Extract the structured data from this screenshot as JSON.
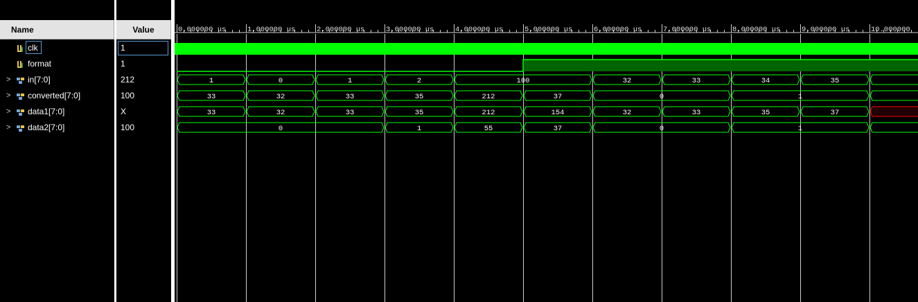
{
  "header": {
    "name_label": "Name",
    "value_label": "Value"
  },
  "colors": {
    "wave": "#00ff00",
    "dim_wave": "#006400",
    "grid": "#d0d0d0",
    "unknown": "#ff0000",
    "background": "#000000"
  },
  "signals": [
    {
      "name": "clk",
      "value": "1",
      "expandable": false,
      "icon": "bit-signal-icon",
      "selected": true
    },
    {
      "name": "format",
      "value": "1",
      "expandable": false,
      "icon": "bit-signal-icon",
      "selected": false
    },
    {
      "name": "in[7:0]",
      "value": "212",
      "expandable": true,
      "icon": "bus-signal-icon",
      "selected": false
    },
    {
      "name": "converted[7:0]",
      "value": "100",
      "expandable": true,
      "icon": "bus-signal-icon",
      "selected": false
    },
    {
      "name": "data1[7:0]",
      "value": "X",
      "expandable": true,
      "icon": "bus-signal-icon",
      "selected": false
    },
    {
      "name": "data2[7:0]",
      "value": "100",
      "expandable": true,
      "icon": "bus-signal-icon",
      "selected": false
    }
  ],
  "timeline": {
    "unit": "us",
    "visible_range": [
      0,
      10.7
    ],
    "tick_labels": [
      "0.000000 us",
      "1.000000 us",
      "2.000000 us",
      "3.000000 us",
      "4.000000 us",
      "5.000000 us",
      "6.000000 us",
      "7.000000 us",
      "8.000000 us",
      "9.000000 us",
      "10.000000"
    ]
  },
  "waves": {
    "clk": {
      "type": "clock",
      "level": 1
    },
    "format": {
      "type": "bit",
      "transitions": [
        {
          "t": 0,
          "v": 0
        },
        {
          "t": 5,
          "v": 1
        }
      ]
    },
    "buses": [
      {
        "signal": "in[7:0]",
        "segments": [
          {
            "t0": 0,
            "t1": 1,
            "label": "1"
          },
          {
            "t0": 1,
            "t1": 2,
            "label": "0"
          },
          {
            "t0": 2,
            "t1": 3,
            "label": "1"
          },
          {
            "t0": 3,
            "t1": 4,
            "label": "2"
          },
          {
            "t0": 4,
            "t1": 6,
            "label": "100"
          },
          {
            "t0": 6,
            "t1": 7,
            "label": "32"
          },
          {
            "t0": 7,
            "t1": 8,
            "label": "33"
          },
          {
            "t0": 8,
            "t1": 9,
            "label": "34"
          },
          {
            "t0": 9,
            "t1": 10,
            "label": "35"
          },
          {
            "t0": 10,
            "t1": 10.8,
            "label": ""
          }
        ]
      },
      {
        "signal": "converted[7:0]",
        "segments": [
          {
            "t0": 0,
            "t1": 1,
            "label": "33"
          },
          {
            "t0": 1,
            "t1": 2,
            "label": "32"
          },
          {
            "t0": 2,
            "t1": 3,
            "label": "33"
          },
          {
            "t0": 3,
            "t1": 4,
            "label": "35"
          },
          {
            "t0": 4,
            "t1": 5,
            "label": "212"
          },
          {
            "t0": 5,
            "t1": 6,
            "label": "37"
          },
          {
            "t0": 6,
            "t1": 8,
            "label": "0"
          },
          {
            "t0": 8,
            "t1": 10,
            "label": "1"
          },
          {
            "t0": 10,
            "t1": 10.8,
            "label": ""
          }
        ]
      },
      {
        "signal": "data1[7:0]",
        "segments": [
          {
            "t0": 0,
            "t1": 1,
            "label": "33"
          },
          {
            "t0": 1,
            "t1": 2,
            "label": "32"
          },
          {
            "t0": 2,
            "t1": 3,
            "label": "33"
          },
          {
            "t0": 3,
            "t1": 4,
            "label": "35"
          },
          {
            "t0": 4,
            "t1": 5,
            "label": "212"
          },
          {
            "t0": 5,
            "t1": 6,
            "label": "154"
          },
          {
            "t0": 6,
            "t1": 7,
            "label": "32"
          },
          {
            "t0": 7,
            "t1": 8,
            "label": "33"
          },
          {
            "t0": 8,
            "t1": 9,
            "label": "35"
          },
          {
            "t0": 9,
            "t1": 10,
            "label": "37"
          },
          {
            "t0": 10,
            "t1": 10.8,
            "label": "",
            "unknown": true
          }
        ]
      },
      {
        "signal": "data2[7:0]",
        "segments": [
          {
            "t0": 0,
            "t1": 3,
            "label": "0"
          },
          {
            "t0": 3,
            "t1": 4,
            "label": "1"
          },
          {
            "t0": 4,
            "t1": 5,
            "label": "55"
          },
          {
            "t0": 5,
            "t1": 6,
            "label": "37"
          },
          {
            "t0": 6,
            "t1": 8,
            "label": "0"
          },
          {
            "t0": 8,
            "t1": 10,
            "label": "1"
          },
          {
            "t0": 10,
            "t1": 10.8,
            "label": ""
          }
        ]
      }
    ]
  }
}
